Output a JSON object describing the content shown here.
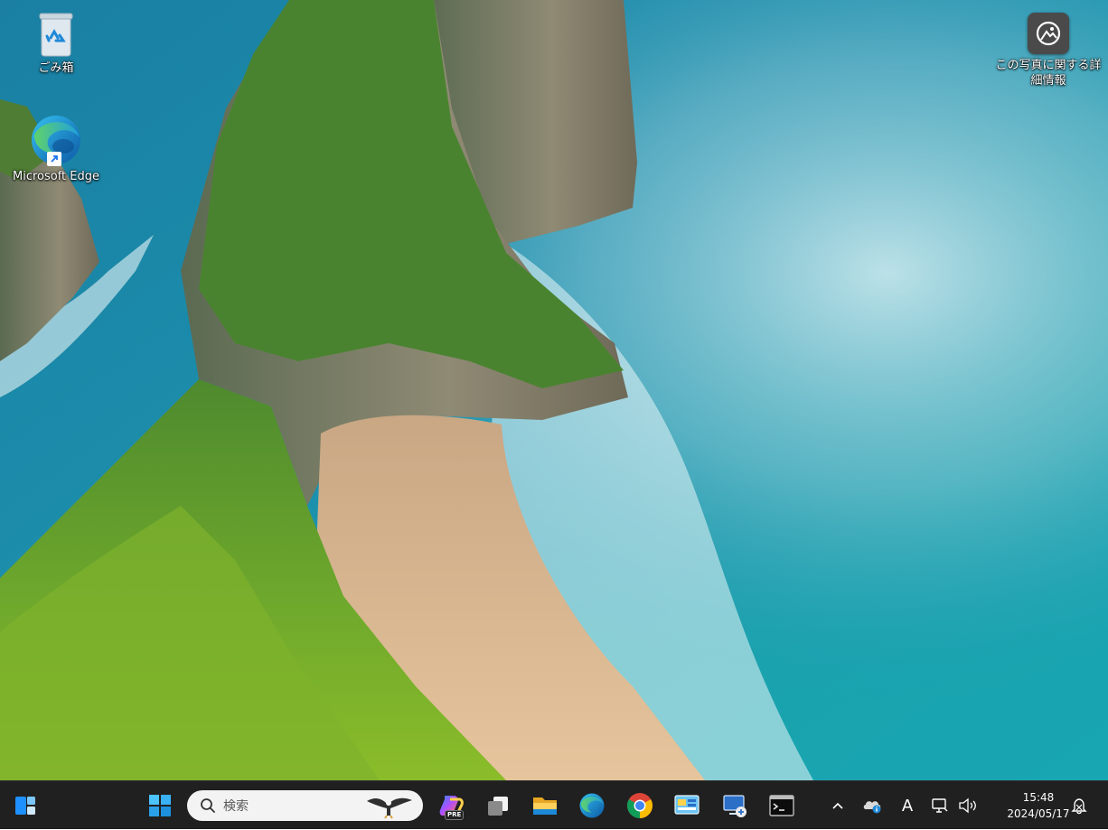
{
  "desktop": {
    "icons": [
      {
        "label": "ごみ箱",
        "icon": "recycle-bin-icon"
      },
      {
        "label": "Microsoft Edge",
        "icon": "edge-icon"
      }
    ],
    "spotlight": {
      "label_line1": "この写真に関する詳",
      "label_line2": "細情報",
      "icon": "camera-info-icon"
    }
  },
  "taskbar": {
    "search_placeholder": "検索",
    "apps": [
      {
        "name": "start",
        "icon": "windows-logo-icon"
      },
      {
        "name": "copilot",
        "icon": "copilot-icon",
        "badge": "PRE"
      },
      {
        "name": "task-view",
        "icon": "task-view-icon"
      },
      {
        "name": "file-explorer",
        "icon": "folder-icon"
      },
      {
        "name": "edge",
        "icon": "edge-icon"
      },
      {
        "name": "chrome",
        "icon": "chrome-icon"
      },
      {
        "name": "control-panel",
        "icon": "control-panel-icon"
      },
      {
        "name": "remote-desktop",
        "icon": "remote-desktop-icon"
      },
      {
        "name": "terminal",
        "icon": "terminal-icon"
      }
    ],
    "tray": {
      "ime": "A",
      "time": "15:48",
      "date": "2024/05/17"
    }
  },
  "colors": {
    "taskbar_bg": "#202020",
    "accent_blue": "#0078d4"
  }
}
